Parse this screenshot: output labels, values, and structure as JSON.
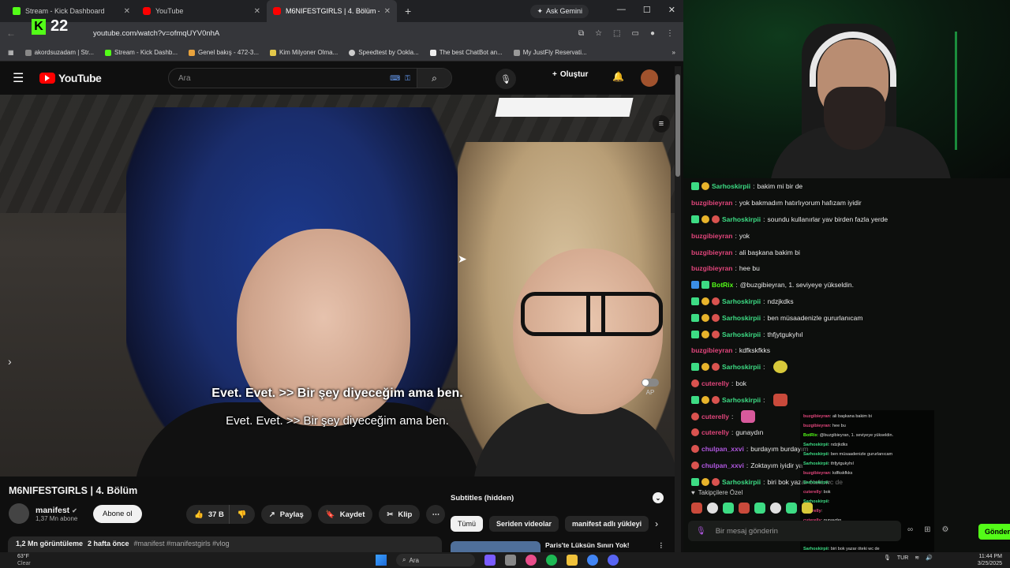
{
  "browser": {
    "tabs": [
      {
        "title": "Stream - Kick Dashboard",
        "favicon": "kick-icon",
        "active": false
      },
      {
        "title": "YouTube",
        "favicon": "youtube-icon",
        "active": false
      },
      {
        "title": "M6NIFESTGIRLS | 4. Bölüm - Yo",
        "favicon": "youtube-icon",
        "active": true
      }
    ],
    "ask_gemini": "Ask Gemini",
    "url": "youtube.com/watch?v=ofmqUYV0nhA",
    "bookmarks": [
      "akordsuzadam | Str...",
      "Stream - Kick Dashb...",
      "Genel bakış - 472-3...",
      "Kim Milyoner Olma...",
      "Speedtest by Ookla...",
      "The best ChatBot an...",
      "My JustFly Reservati..."
    ]
  },
  "kick_overlay": {
    "viewers": "22"
  },
  "youtube": {
    "logo_text": "YouTube",
    "search_placeholder": "Ara",
    "create_label": "Oluştur",
    "video": {
      "caption_line1": "Evet. Evet. >> Bir şey diyeceğim ama ben.",
      "caption_line2": "Evet. Evet. >> Bir şey diyeceğim ama ben.",
      "autoplay_label": "AP"
    },
    "title": "M6NIFESTGIRLS | 4. Bölüm",
    "channel": {
      "name": "manifest",
      "subs": "1,37 Mn abone",
      "subscribe_label": "Abone ol"
    },
    "actions": {
      "likes": "37 B",
      "share": "Paylaş",
      "save": "Kaydet",
      "clip": "Klip"
    },
    "description": {
      "views": "1,2 Mn görüntüleme",
      "ago": "2 hafta önce",
      "tags": "#manifest #manifestgirls #vlog"
    },
    "side": {
      "subtitles_label": "Subtitles (hidden)",
      "chips": [
        "Tümü",
        "Seriden videolar",
        "manifest adlı yükleyi"
      ],
      "reco_title": "Paris'te Lüksün Sınırı Yok!"
    }
  },
  "chat": {
    "messages": [
      {
        "user": "Sarhoskirpii",
        "color": "#3ddc84",
        "badges": [
          "b-green",
          "b-gold"
        ],
        "text": "bakim mi bir de"
      },
      {
        "user": "buzgibieyran",
        "color": "#e0457b",
        "badges": [],
        "text": "yok bakmadım hatırlıyorum hafızam iyidir"
      },
      {
        "user": "Sarhoskirpii",
        "color": "#3ddc84",
        "badges": [
          "b-green",
          "b-gold",
          "b-red"
        ],
        "text": "soundu kullanırlar yav birden fazla yerde"
      },
      {
        "user": "buzgibieyran",
        "color": "#e0457b",
        "badges": [],
        "text": "yok"
      },
      {
        "user": "buzgibieyran",
        "color": "#e0457b",
        "badges": [],
        "text": "ali başkana bakim bi"
      },
      {
        "user": "buzgibieyran",
        "color": "#e0457b",
        "badges": [],
        "text": "hee bu"
      },
      {
        "user": "BotRix",
        "color": "#53fc18",
        "badges": [
          "b-blue",
          "b-green"
        ],
        "text": "@buzgibieyran, 1. seviyeye yükseldin."
      },
      {
        "user": "Sarhoskirpii",
        "color": "#3ddc84",
        "badges": [
          "b-green",
          "b-gold",
          "b-red"
        ],
        "text": "ndzjkdks"
      },
      {
        "user": "Sarhoskirpii",
        "color": "#3ddc84",
        "badges": [
          "b-green",
          "b-gold",
          "b-red"
        ],
        "text": "ben müsaadenizle gururlanıcam"
      },
      {
        "user": "Sarhoskirpii",
        "color": "#3ddc84",
        "badges": [
          "b-green",
          "b-gold",
          "b-red"
        ],
        "text": "thfjytgukyhıl"
      },
      {
        "user": "buzgibieyran",
        "color": "#e0457b",
        "badges": [],
        "text": "kdfkskfkks"
      },
      {
        "user": "Sarhoskirpii",
        "color": "#3ddc84",
        "badges": [
          "b-green",
          "b-gold",
          "b-red"
        ],
        "text": "",
        "emote": "yel"
      },
      {
        "user": "cuterelly",
        "color": "#e0457b",
        "badges": [
          "b-red"
        ],
        "text": "bok"
      },
      {
        "user": "Sarhoskirpii",
        "color": "#3ddc84",
        "badges": [
          "b-green",
          "b-gold",
          "b-red"
        ],
        "text": "",
        "emote": "red"
      },
      {
        "user": "cuterelly",
        "color": "#e0457b",
        "badges": [
          "b-red"
        ],
        "text": "",
        "emote": "pink"
      },
      {
        "user": "cuterelly",
        "color": "#e0457b",
        "badges": [
          "b-red"
        ],
        "text": "gunaydın"
      },
      {
        "user": "chulpan_xxvi",
        "color": "#b057e0",
        "badges": [
          "b-red"
        ],
        "text": "burdayım burdayım"
      },
      {
        "user": "chulpan_xxvi",
        "color": "#b057e0",
        "badges": [
          "b-red"
        ],
        "text": "Zoktayım iyidir ya"
      },
      {
        "user": "Sarhoskirpii",
        "color": "#3ddc84",
        "badges": [
          "b-green",
          "b-gold",
          "b-red"
        ],
        "text": "biri bok yazar öteki wc de"
      }
    ],
    "mini_overlay": [
      {
        "user": "buzgibieyran",
        "text": ": ali başkana bakim bi"
      },
      {
        "user": "buzgibieyran",
        "text": ": hee bu"
      },
      {
        "user": "BotRix",
        "text": ": @buzgibieyran, 1. seviyeye yükseldin."
      },
      {
        "user": "Sarhoskirpii",
        "text": ": ndzjkdks"
      },
      {
        "user": "Sarhoskirpii",
        "text": ": ben müsaadenizle gururlanıcam"
      },
      {
        "user": "Sarhoskirpii",
        "text": ": thfjytgukyhıl"
      },
      {
        "user": "buzgibieyran",
        "text": ": kdfkskfkks"
      },
      {
        "user": "Sarhoskirpii",
        "text": ":"
      },
      {
        "user": "cuterelly",
        "text": ": bok"
      },
      {
        "user": "Sarhoskirpii",
        "text": ":"
      },
      {
        "user": "cuterelly",
        "text": ":"
      },
      {
        "user": "cuterelly",
        "text": ": gunaydın"
      },
      {
        "user": "chulpan_xxvi",
        "text": ": burdayım burdayım wc gittin"
      },
      {
        "user": "chulpan_xxvi",
        "text": ": Zoktayım iyidir ya"
      },
      {
        "user": "Sarhoskirpii",
        "text": ": biri bok yazar öteki wc de"
      }
    ],
    "followers_label": "Takipçilere Özel",
    "input_placeholder": "Bir mesaj gönderin",
    "send_label": "Gönder"
  },
  "taskbar": {
    "temp": "63°F",
    "condition": "Clear",
    "search_label": "Ara",
    "lang": "TUR",
    "time": "11:44 PM",
    "date": "3/25/2025"
  }
}
